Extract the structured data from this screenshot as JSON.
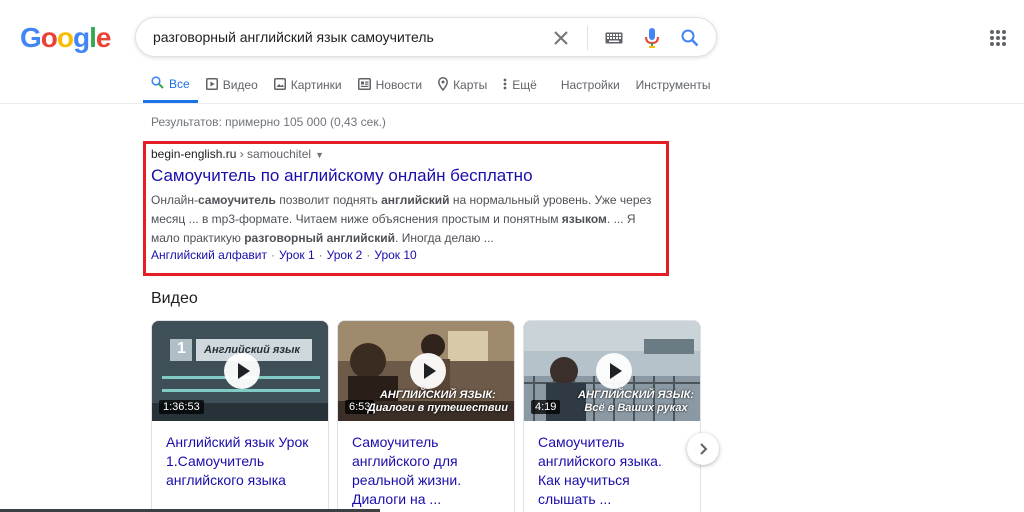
{
  "logo": [
    "G",
    "o",
    "o",
    "g",
    "l",
    "e"
  ],
  "logo_colors": [
    "#4285f4",
    "#ea4335",
    "#fbbc05",
    "#4285f4",
    "#34a853",
    "#ea4335"
  ],
  "search": {
    "value": "разговорный английский язык самоучитель"
  },
  "tabs": [
    {
      "label": "Все",
      "icon": "search-icon"
    },
    {
      "label": "Видео",
      "icon": "video-icon"
    },
    {
      "label": "Картинки",
      "icon": "image-icon"
    },
    {
      "label": "Новости",
      "icon": "news-icon"
    },
    {
      "label": "Карты",
      "icon": "map-pin-icon"
    },
    {
      "label": "Ещё",
      "icon": "more-vert-icon"
    },
    {
      "label": "Настройки"
    },
    {
      "label": "Инструменты"
    }
  ],
  "stats": "Результатов: примерно 105 000 (0,43 сек.)",
  "result": {
    "domain": "begin-english.ru",
    "path": " › samouchitel",
    "title": "Самоучитель по английскому онлайн бесплатно",
    "snippet": [
      {
        "t": "Онлайн-",
        "b": false
      },
      {
        "t": "самоучитель",
        "b": true
      },
      {
        "t": " позволит поднять ",
        "b": false
      },
      {
        "t": "английский",
        "b": true
      },
      {
        "t": " на нормальный уровень. Уже через месяц ... в mp3-формате. Читаем ниже объяснения простым и понятным ",
        "b": false
      },
      {
        "t": "языком",
        "b": true
      },
      {
        "t": ". ... Я мало практикую ",
        "b": false
      },
      {
        "t": "разговорный английский",
        "b": true
      },
      {
        "t": ". Иногда делаю ...",
        "b": false
      }
    ],
    "sitelinks": [
      "Английский алфавит",
      "Урок 1",
      "Урок 2",
      "Урок 10"
    ]
  },
  "video_heading": "Видео",
  "videos": [
    {
      "duration": "1:36:53",
      "title": "Английский язык Урок 1.Самоучитель английского языка",
      "thumb_number": "1",
      "thumb_text": "Английский язык",
      "overlay": ""
    },
    {
      "duration": "6:53",
      "title": "Самоучитель английского для реальной жизни. Диалоги на ...",
      "thumb_number": "",
      "thumb_text": "",
      "overlay": "АНГЛИЙСКИЙ ЯЗЫК:\nДиалоги в путешествии"
    },
    {
      "duration": "4:19",
      "title": "Самоучитель английского языка. Как научиться слышать ...",
      "thumb_number": "",
      "thumb_text": "",
      "overlay": "АНГЛИЙСКИЙ ЯЗЫК:\nВсё в Ваших руках"
    }
  ]
}
